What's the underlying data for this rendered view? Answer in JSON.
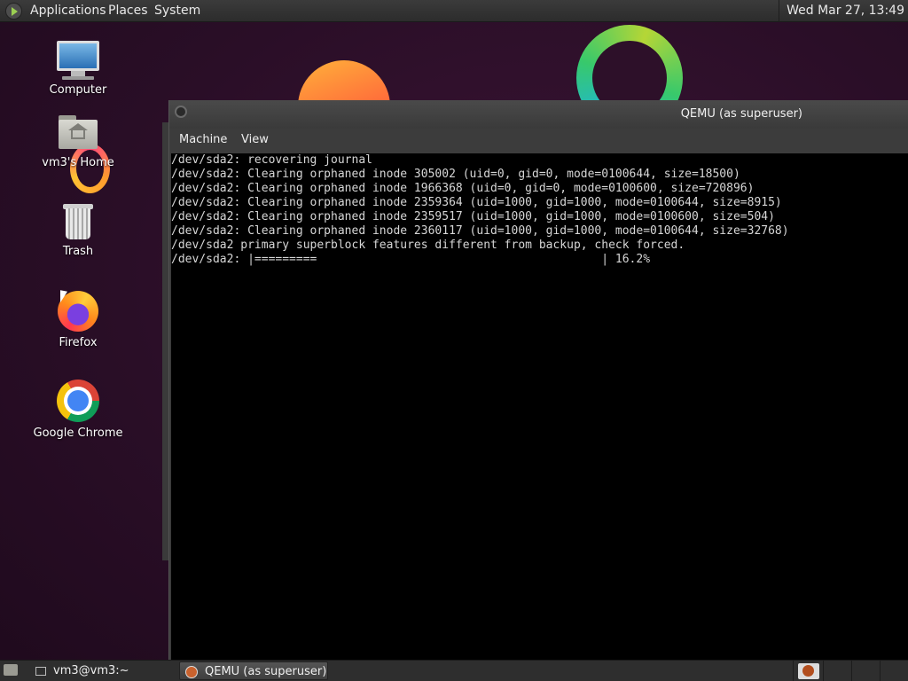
{
  "top_panel": {
    "menus": [
      "Applications",
      "Places",
      "System"
    ],
    "clock": "Wed Mar 27, 13:49"
  },
  "desktop": {
    "icons": [
      {
        "label": "Computer",
        "icon": "computer-icon"
      },
      {
        "label": "vm3's Home",
        "icon": "home-folder-icon"
      },
      {
        "label": "Trash",
        "icon": "trash-icon"
      },
      {
        "label": "Firefox",
        "icon": "firefox-icon"
      },
      {
        "label": "Google Chrome",
        "icon": "chrome-icon"
      }
    ]
  },
  "qemu": {
    "title": "QEMU (as superuser)",
    "menu": [
      "Machine",
      "View"
    ],
    "console": [
      "/dev/sda2: recovering journal",
      "/dev/sda2: Clearing orphaned inode 305002 (uid=0, gid=0, mode=0100644, size=18500)",
      "/dev/sda2: Clearing orphaned inode 1966368 (uid=0, gid=0, mode=0100600, size=720896)",
      "/dev/sda2: Clearing orphaned inode 2359364 (uid=1000, gid=1000, mode=0100644, size=8915)",
      "/dev/sda2: Clearing orphaned inode 2359517 (uid=1000, gid=1000, mode=0100600, size=504)",
      "/dev/sda2: Clearing orphaned inode 2360117 (uid=1000, gid=1000, mode=0100644, size=32768)",
      "/dev/sda2 primary superblock features different from backup, check forced.",
      "/dev/sda2: |=========                                         | 16.2%"
    ]
  },
  "taskbar": {
    "tasks": [
      "vm3@vm3:~",
      "QEMU (as superuser)"
    ]
  },
  "colors": {
    "wallpaper": "#2a0e27",
    "panel": "#2e2e2e",
    "console_bg": "#000000",
    "console_fg": "#d6d6d6"
  }
}
